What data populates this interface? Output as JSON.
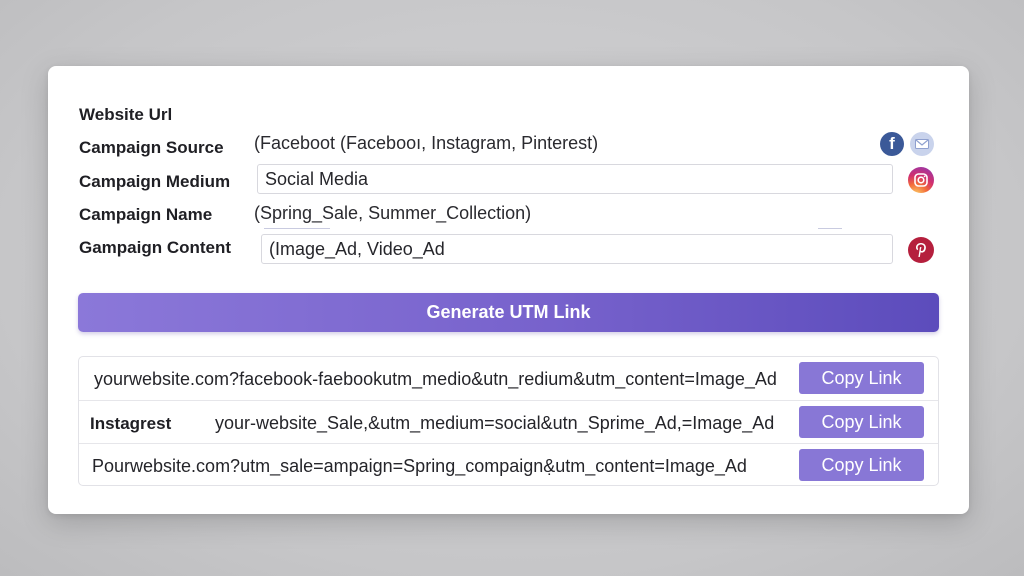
{
  "form": {
    "website_url_label": "Website Url",
    "campaign_source_label": "Campaign Source",
    "campaign_source_hint": "(Faceboot (Facebooı, Instagram, Pinterest)",
    "campaign_medium_label": "Campaign Medium",
    "campaign_medium_value": "Social Media",
    "campaign_name_label": "Campaign Name",
    "campaign_name_hint": "(Spring_Sale, Summer_Collection)",
    "campaign_content_label": "Gampaign Content",
    "campaign_content_value": "(Image_Ad, Video_Ad"
  },
  "icons": [
    "facebook-icon",
    "mail-icon",
    "instagram-icon",
    "pinterest-icon"
  ],
  "generate_button": {
    "label": "Generate UTM Link"
  },
  "results": [
    {
      "prefix": "",
      "link": "yourwebsite.com?facebook-faebookutm_medio&utn_redium&utm_content=Image_Ad",
      "copy_label": "Copy Link"
    },
    {
      "prefix": "Instagrest",
      "link": "your-website_Sale,&utm_medium=social&utn_Sprime_Ad,=Image_Ad",
      "copy_label": "Copy Link"
    },
    {
      "prefix": "",
      "link": "Pourwebsite.com?utm_sale=ampaign=Spring_compaign&̣utm_content=Image_Ad",
      "copy_label": "Copy Link"
    }
  ],
  "colors": {
    "accent": "#7762cc",
    "copy_button": "#8877d6",
    "facebook": "#3b5998",
    "pinterest": "#b51f3d"
  }
}
